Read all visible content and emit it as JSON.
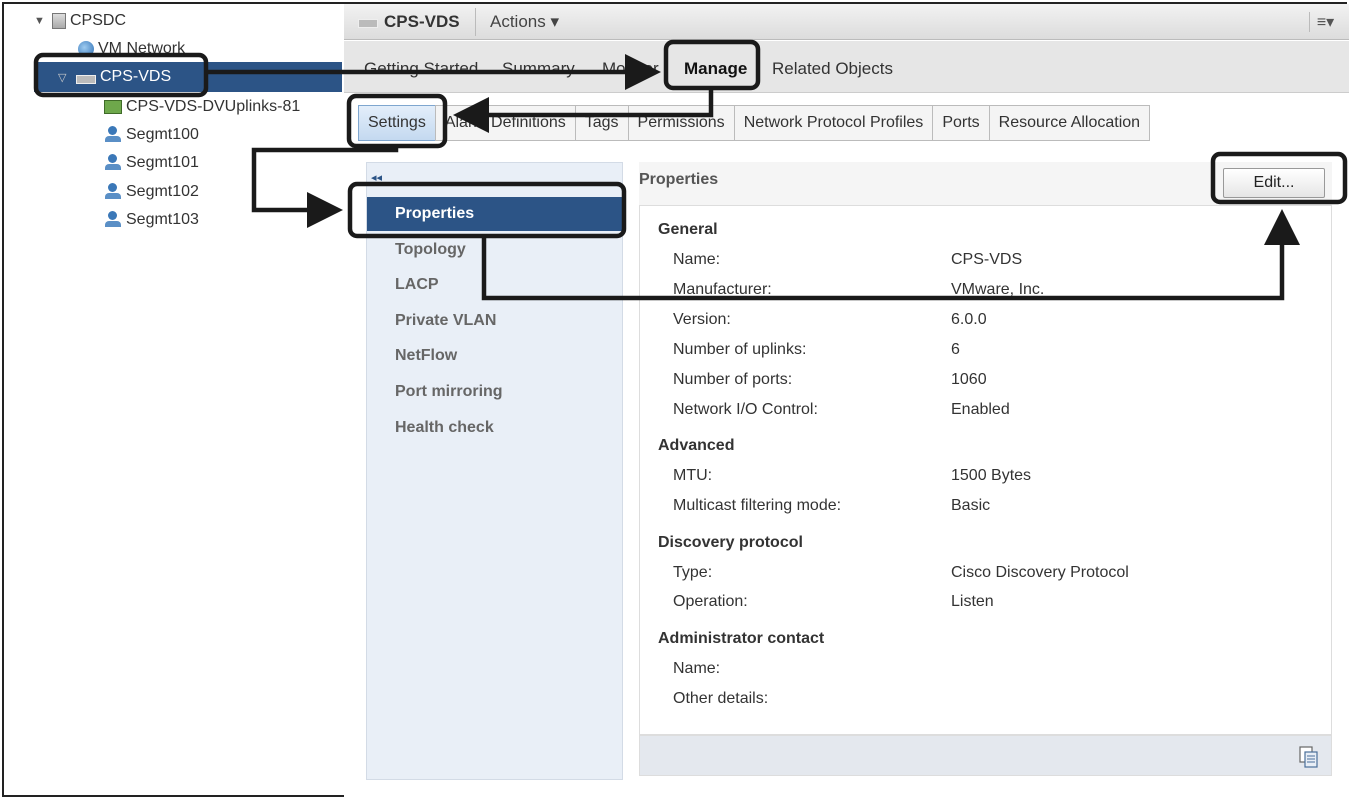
{
  "tree": {
    "items": [
      {
        "label": "CPSDC",
        "icon": "datacenter-icon"
      },
      {
        "label": "VM Network",
        "icon": "network-icon"
      },
      {
        "label": "CPS-VDS",
        "icon": "distributed-switch-icon"
      },
      {
        "label": "CPS-VDS-DVUplinks-81",
        "icon": "uplinks-icon"
      },
      {
        "label": "Segmt100",
        "icon": "port-group-icon"
      },
      {
        "label": "Segmt101",
        "icon": "port-group-icon"
      },
      {
        "label": "Segmt102",
        "icon": "port-group-icon"
      },
      {
        "label": "Segmt103",
        "icon": "port-group-icon"
      }
    ]
  },
  "titlebar": {
    "object": "CPS-VDS",
    "actions": "Actions ▾",
    "menu": "≡▾"
  },
  "navtabs": [
    "Getting Started",
    "Summary",
    "Monitor",
    "Manage",
    "Related Objects"
  ],
  "subtabs": [
    "Settings",
    "Alarm Definitions",
    "Tags",
    "Permissions",
    "Network Protocol Profiles",
    "Ports",
    "Resource Allocation"
  ],
  "leftnav": {
    "collapse": "◂◂",
    "items": [
      "Properties",
      "Topology",
      "LACP",
      "Private VLAN",
      "NetFlow",
      "Port mirroring",
      "Health check"
    ]
  },
  "content": {
    "header": "Properties",
    "edit_button": "Edit...",
    "sections": [
      {
        "title": "General",
        "rows": [
          {
            "label": "Name:",
            "value": "CPS-VDS"
          },
          {
            "label": "Manufacturer:",
            "value": "VMware, Inc."
          },
          {
            "label": "Version:",
            "value": "6.0.0"
          },
          {
            "label": "Number of uplinks:",
            "value": "6"
          },
          {
            "label": "Number of ports:",
            "value": "1060"
          },
          {
            "label": "Network I/O Control:",
            "value": "Enabled"
          }
        ]
      },
      {
        "title": "Advanced",
        "rows": [
          {
            "label": "MTU:",
            "value": "1500 Bytes"
          },
          {
            "label": "Multicast filtering mode:",
            "value": "Basic"
          }
        ]
      },
      {
        "title": "Discovery protocol",
        "rows": [
          {
            "label": "Type:",
            "value": "Cisco Discovery Protocol"
          },
          {
            "label": "Operation:",
            "value": "Listen"
          }
        ]
      },
      {
        "title": "Administrator contact",
        "rows": [
          {
            "label": "Name:",
            "value": ""
          },
          {
            "label": "Other details:",
            "value": ""
          }
        ]
      }
    ]
  },
  "colors": {
    "accent": "#2c5486",
    "callout": "#1a1a1a"
  }
}
